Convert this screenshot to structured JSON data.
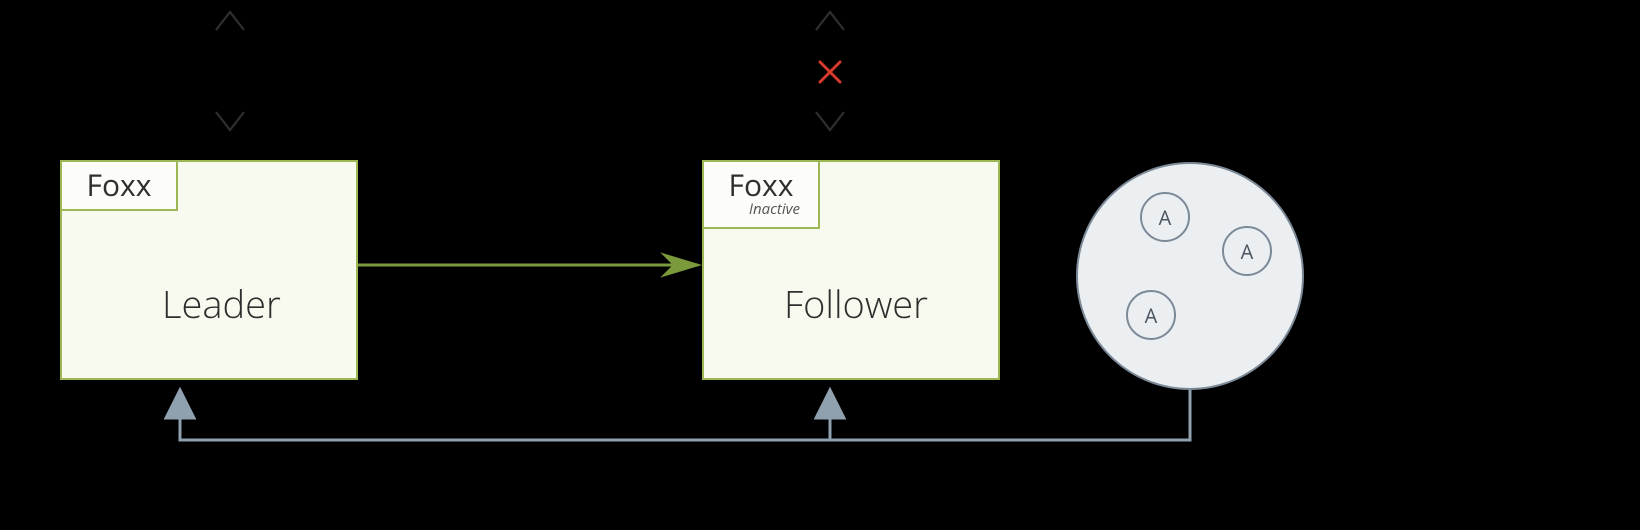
{
  "diagram": {
    "leader": {
      "label": "Leader",
      "foxx_label": "Foxx"
    },
    "follower": {
      "label": "Follower",
      "foxx_label": "Foxx",
      "foxx_status": "Inactive"
    },
    "agency": {
      "node_a_label": "A",
      "node_b_label": "A",
      "node_c_label": "A"
    },
    "colors": {
      "box_border": "#9cb753",
      "box_fill": "#f8f9ef",
      "arrow_green": "#7a9a3b",
      "agency_border": "#7c8a97",
      "agency_fill": "#eceff1",
      "client_arrow": "#2f2f2f",
      "blocked": "#d63b2a",
      "supervise": "#8fa0ae"
    }
  }
}
